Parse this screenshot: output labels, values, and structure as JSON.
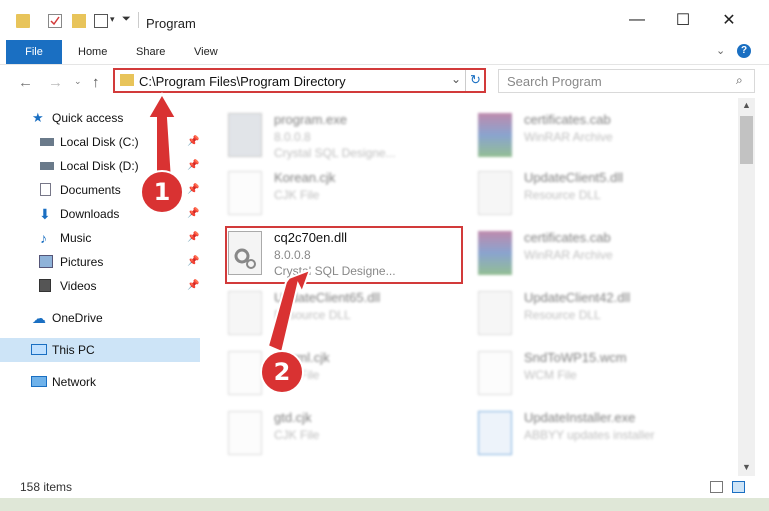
{
  "window": {
    "title": "Program",
    "minimize": "—",
    "maximize": "☐",
    "close": "✕"
  },
  "ribbon": {
    "tabs": [
      "File",
      "Home",
      "Share",
      "View"
    ],
    "help": "?"
  },
  "nav": {
    "address": "C:\\Program Files\\Program Directory",
    "search_placeholder": "Search Program"
  },
  "sidebar": {
    "quick_access": "Quick access",
    "items": [
      {
        "label": "Local Disk (C:)",
        "icon": "drive-icon"
      },
      {
        "label": "Local Disk (D:)",
        "icon": "drive-icon"
      },
      {
        "label": "Documents",
        "icon": "documents-icon"
      },
      {
        "label": "Downloads",
        "icon": "downloads-icon"
      },
      {
        "label": "Music",
        "icon": "music-icon"
      },
      {
        "label": "Pictures",
        "icon": "pictures-icon"
      },
      {
        "label": "Videos",
        "icon": "videos-icon"
      }
    ],
    "onedrive": "OneDrive",
    "this_pc": "This PC",
    "network": "Network"
  },
  "files": [
    {
      "name": "program.exe",
      "line2": "8.0.0.8",
      "line3": "Crystal SQL Designe...",
      "icon": "exe"
    },
    {
      "name": "certificates.cab",
      "line2": "WinRAR Archive",
      "line3": "",
      "icon": "rar"
    },
    {
      "name": "Korean.cjk",
      "line2": "CJK File",
      "line3": "",
      "icon": "doc"
    },
    {
      "name": "UpdateClient5.dll",
      "line2": "Resource DLL",
      "line3": "",
      "icon": "dll"
    },
    {
      "name": "cq2c70en.dll",
      "line2": "8.0.0.8",
      "line3": "Crystal SQL Designe...",
      "icon": "dll"
    },
    {
      "name": "certificates.cab",
      "line2": "WinRAR Archive",
      "line3": "",
      "icon": "rar"
    },
    {
      "name": "UpdateClient65.dll",
      "line2": "Resource DLL",
      "line3": "",
      "icon": "dll"
    },
    {
      "name": "UpdateClient42.dll",
      "line2": "Resource DLL",
      "line3": "",
      "icon": "dll"
    },
    {
      "name": "pthrml.cjk",
      "line2": "CJK File",
      "line3": "",
      "icon": "doc"
    },
    {
      "name": "SndToWP15.wcm",
      "line2": "WCM File",
      "line3": "",
      "icon": "doc"
    },
    {
      "name": "gtd.cjk",
      "line2": "CJK File",
      "line3": "",
      "icon": "doc"
    },
    {
      "name": "UpdateInstaller.exe",
      "line2": "ABBYY updates installer",
      "line3": "",
      "icon": "installer"
    }
  ],
  "status": {
    "items_count": "158 items"
  },
  "annotations": {
    "step1": "1",
    "step2": "2"
  },
  "colors": {
    "accent": "#1a6fc2",
    "callout": "#d23a3a",
    "selected_nav": "#cde4f7"
  }
}
